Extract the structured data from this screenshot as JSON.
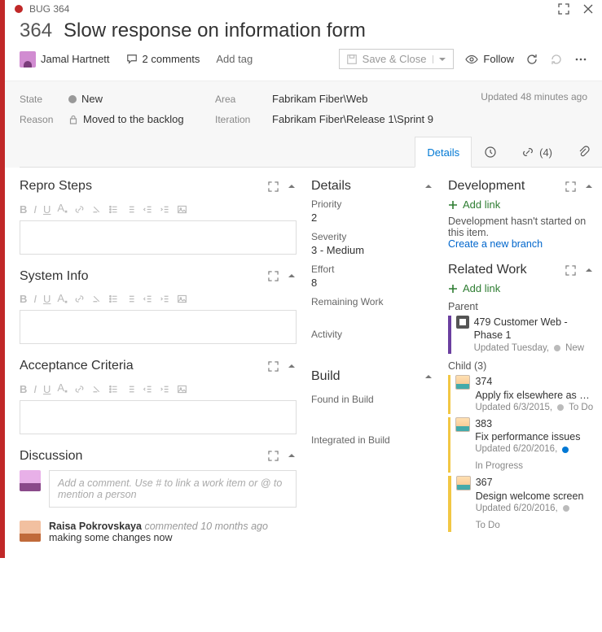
{
  "window": {
    "tag": "BUG 364"
  },
  "bug": {
    "id": "364",
    "title": "Slow response on information form"
  },
  "toolbar": {
    "person": "Jamal Hartnett",
    "comments": "2 comments",
    "add_tag": "Add tag",
    "save": "Save & Close",
    "follow": "Follow"
  },
  "meta": {
    "state_label": "State",
    "state": "New",
    "reason_label": "Reason",
    "reason": "Moved to the backlog",
    "area_label": "Area",
    "area": "Fabrikam Fiber\\Web",
    "iteration_label": "Iteration",
    "iteration": "Fabrikam Fiber\\Release 1\\Sprint 9",
    "updated": "Updated 48 minutes ago"
  },
  "tabs": {
    "details": "Details",
    "links_count": "(4)"
  },
  "left": {
    "repro": "Repro Steps",
    "system": "System Info",
    "acceptance": "Acceptance Criteria",
    "discussion": "Discussion",
    "comment_placeholder": "Add a comment. Use # to link a work item or @ to mention a person"
  },
  "mid": {
    "details_header": "Details",
    "priority_label": "Priority",
    "priority": "2",
    "severity_label": "Severity",
    "severity": "3 - Medium",
    "effort_label": "Effort",
    "effort": "8",
    "remaining_label": "Remaining Work",
    "remaining": "",
    "activity_label": "Activity",
    "activity": "",
    "build_header": "Build",
    "found_label": "Found in Build",
    "found": "",
    "integrated_label": "Integrated in Build",
    "integrated": ""
  },
  "right": {
    "dev_header": "Development",
    "add_link": "Add link",
    "dev_msg": "Development hasn't started on this item.",
    "create_branch": "Create a new branch",
    "related_header": "Related Work",
    "parent_label": "Parent",
    "child_label": "Child (3)",
    "parent": {
      "id": "479",
      "title": "Customer Web - Phase 1",
      "sub": "Updated Tuesday,",
      "state": "New"
    },
    "children": [
      {
        "id": "374",
        "title": "Apply fix elsewhere as n…",
        "sub": "Updated 6/3/2015,",
        "state": "To Do",
        "state_blue": false
      },
      {
        "id": "383",
        "title": "Fix performance issues",
        "sub": "Updated 6/20/2016,",
        "state": "In Progress",
        "state_blue": true
      },
      {
        "id": "367",
        "title": "Design welcome screen",
        "sub": "Updated 6/20/2016,",
        "state": "To Do",
        "state_blue": false
      }
    ]
  },
  "discussion": {
    "author": "Raisa Pokrovskaya",
    "when": "commented 10 months ago",
    "body": "making some changes now"
  }
}
